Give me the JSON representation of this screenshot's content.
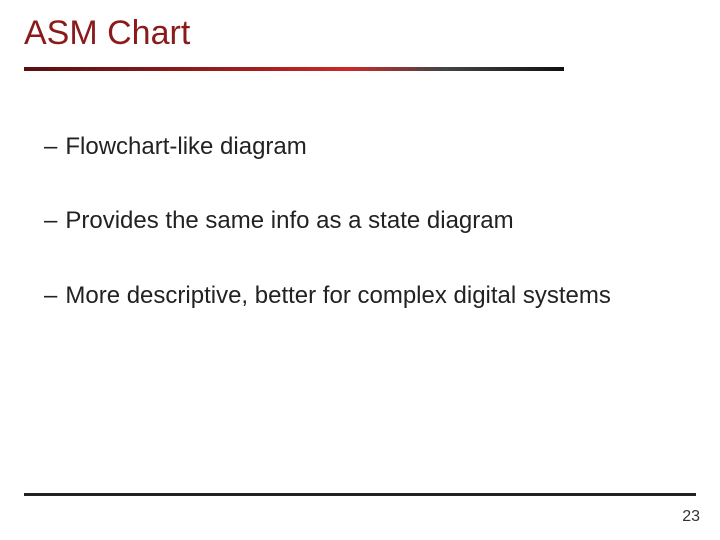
{
  "title": "ASM Chart",
  "bullets": [
    "Flowchart-like diagram",
    "Provides the same info as a state diagram",
    "More descriptive, better for complex digital systems"
  ],
  "page_number": "23"
}
